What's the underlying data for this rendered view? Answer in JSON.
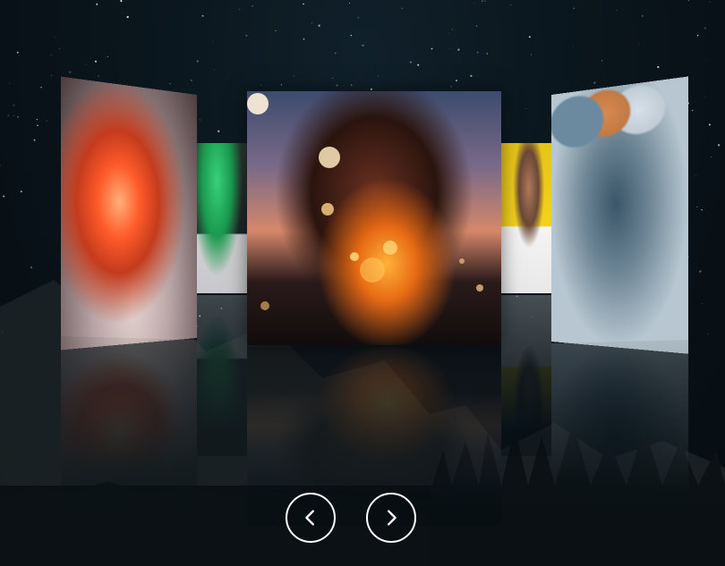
{
  "carousel": {
    "slides": [
      {
        "name": "smoke-portrait",
        "position": "far-left"
      },
      {
        "name": "green-smoke-portrait",
        "position": "left"
      },
      {
        "name": "fairy-lights-portrait",
        "position": "center"
      },
      {
        "name": "sunglasses-portrait",
        "position": "right"
      },
      {
        "name": "balloons-smoke-portrait",
        "position": "far-right"
      }
    ],
    "controls": {
      "prev_icon": "chevron-left-icon",
      "next_icon": "chevron-right-icon"
    }
  },
  "colors": {
    "button_border": "#ffffff",
    "background": "#071016"
  }
}
